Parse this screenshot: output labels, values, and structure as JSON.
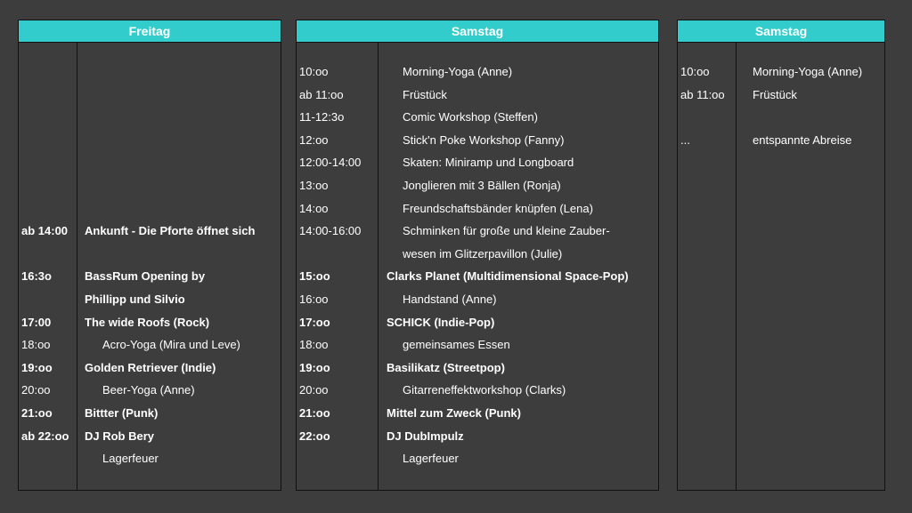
{
  "columns": [
    {
      "title": "Freitag",
      "rows": [
        {
          "slot": 8,
          "time": "ab 14:00",
          "event": "Ankunft - Die Pforte öffnet sich",
          "bold": true,
          "indent": false
        },
        {
          "slot": 10,
          "time": "16:3o",
          "event": "BassRum Opening by",
          "bold": true,
          "indent": false
        },
        {
          "slot": 11,
          "time": "",
          "event": "Phillipp und Silvio",
          "bold": true,
          "indent": false
        },
        {
          "slot": 12,
          "time": "17:00",
          "event": "The wide Roofs (Rock)",
          "bold": true,
          "indent": false
        },
        {
          "slot": 13,
          "time": "18:oo",
          "event": "Acro-Yoga (Mira und Leve)",
          "bold": false,
          "indent": true
        },
        {
          "slot": 14,
          "time": "19:oo",
          "event": "Golden Retriever (Indie)",
          "bold": true,
          "indent": false
        },
        {
          "slot": 15,
          "time": "20:oo",
          "event": "Beer-Yoga (Anne)",
          "bold": false,
          "indent": true
        },
        {
          "slot": 16,
          "time": "21:oo",
          "event": "Bittter (Punk)",
          "bold": true,
          "indent": false
        },
        {
          "slot": 17,
          "time": "ab 22:oo",
          "event": "DJ Rob Bery",
          "bold": true,
          "indent": false
        },
        {
          "slot": 18,
          "time": "",
          "event": "Lagerfeuer",
          "bold": false,
          "indent": true
        }
      ]
    },
    {
      "title": "Samstag",
      "rows": [
        {
          "slot": 1,
          "time": "10:oo",
          "event": "Morning-Yoga (Anne)",
          "bold": false,
          "indent": true
        },
        {
          "slot": 2,
          "time": "ab 11:oo",
          "event": "Früstück",
          "bold": false,
          "indent": true
        },
        {
          "slot": 3,
          "time": "11-12:3o",
          "event": "Comic Workshop (Steffen)",
          "bold": false,
          "indent": true
        },
        {
          "slot": 4,
          "time": "12:oo",
          "event": "Stick'n Poke Workshop (Fanny)",
          "bold": false,
          "indent": true
        },
        {
          "slot": 5,
          "time": "12:00-14:00",
          "event": "Skaten: Miniramp und Longboard",
          "bold": false,
          "indent": true
        },
        {
          "slot": 6,
          "time": "13:oo",
          "event": "Jonglieren mit 3 Bällen (Ronja)",
          "bold": false,
          "indent": true
        },
        {
          "slot": 7,
          "time": "14:oo",
          "event": "Freundschaftsbänder knüpfen (Lena)",
          "bold": false,
          "indent": true
        },
        {
          "slot": 8,
          "time": "14:00-16:00",
          "event": "Schminken für große und kleine Zauber-",
          "bold": false,
          "indent": true
        },
        {
          "slot": 9,
          "time": "",
          "event": "wesen im Glitzerpavillon (Julie)",
          "bold": false,
          "indent": true
        },
        {
          "slot": 10,
          "time": "15:oo",
          "event": "Clarks Planet (Multidimensional Space-Pop)",
          "bold": true,
          "indent": false
        },
        {
          "slot": 11,
          "time": "16:oo",
          "event": "Handstand (Anne)",
          "bold": false,
          "indent": true
        },
        {
          "slot": 12,
          "time": "17:oo",
          "event": "SCHICK (Indie-Pop)",
          "bold": true,
          "indent": false
        },
        {
          "slot": 13,
          "time": "18:oo",
          "event": "gemeinsames Essen",
          "bold": false,
          "indent": true
        },
        {
          "slot": 14,
          "time": "19:oo",
          "event": "Basilikatz (Streetpop)",
          "bold": true,
          "indent": false
        },
        {
          "slot": 15,
          "time": "20:oo",
          "event": "Gitarreneffektworkshop (Clarks)",
          "bold": false,
          "indent": true
        },
        {
          "slot": 16,
          "time": "21:oo",
          "event": "Mittel zum Zweck (Punk)",
          "bold": true,
          "indent": false
        },
        {
          "slot": 17,
          "time": "22:oo",
          "event": "DJ DubImpulz",
          "bold": true,
          "indent": false
        },
        {
          "slot": 18,
          "time": "",
          "event": "Lagerfeuer",
          "bold": false,
          "indent": true
        }
      ]
    },
    {
      "title": "Samstag",
      "rows": [
        {
          "slot": 1,
          "time": "10:oo",
          "event": "Morning-Yoga (Anne)",
          "bold": false,
          "indent": false
        },
        {
          "slot": 2,
          "time": "ab 11:oo",
          "event": "Früstück",
          "bold": false,
          "indent": false
        },
        {
          "slot": 4,
          "time": "...",
          "event": "entspannte Abreise",
          "bold": false,
          "indent": false
        }
      ]
    }
  ]
}
